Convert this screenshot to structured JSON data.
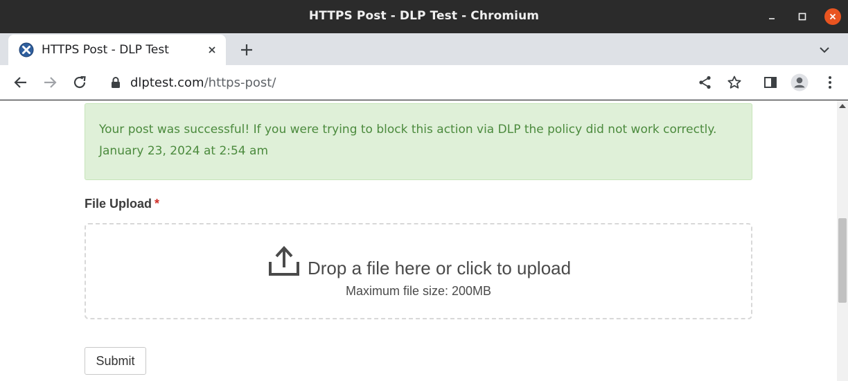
{
  "window": {
    "title": "HTTPS Post - DLP Test - Chromium"
  },
  "tab": {
    "title": "HTTPS Post - DLP Test",
    "favicon": "dlp-x-logo-icon"
  },
  "omnibox": {
    "host": "dlptest.com",
    "path": "/https-post/"
  },
  "page": {
    "success_message": "Your post was successful! If you were trying to block this action via DLP the policy did not work correctly.",
    "success_date": "January 23, 2024 at 2:54 am",
    "upload_label": "File Upload",
    "required_mark": "*",
    "drop_text": "Drop a file here or click to upload",
    "max_size": "Maximum file size: 200MB",
    "submit_label": "Submit"
  },
  "colors": {
    "close_button": "#e95420",
    "success_bg": "#dff0d8",
    "success_text": "#4b8a3d",
    "required": "#d0302a"
  }
}
